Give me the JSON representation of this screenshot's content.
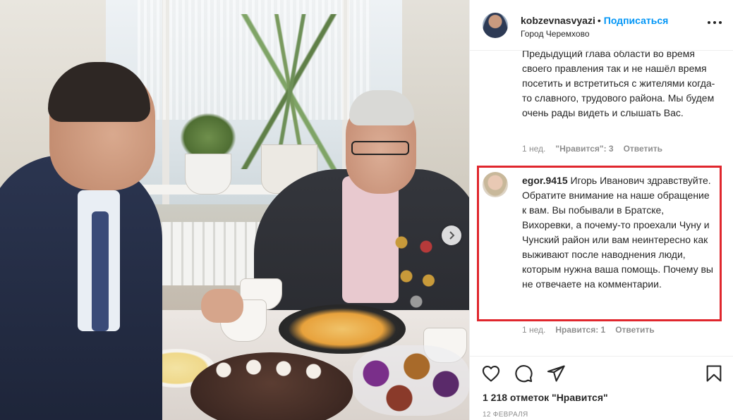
{
  "post": {
    "owner": "kobzevnasvyazi",
    "follow_label": "Подписаться",
    "separator": "•",
    "location": "Город Черемхово"
  },
  "comments": [
    {
      "text": "Предыдущий глава области во время своего правления так и не нашёл время посетить и встретиться с жителями когда-то славного, трудового района. Мы будем очень рады видеть и слышать Вас.",
      "time": "1 нед.",
      "likes": "\"Нравится\": 3",
      "reply": "Ответить"
    },
    {
      "user": "egor.9415",
      "text": "Игорь Иванович здравствуйте. Обратите внимание на наше обращение к вам. Вы побывали в Братске, Вихоревки, а почему-то проехали Чуну и Чунский район или вам неинтересно как выживают после наводнения люди, которым нужна ваша помощь. Почему вы не отвечаете на комментарии.",
      "time": "1 нед.",
      "likes": "Нравится: 1",
      "reply": "Ответить"
    }
  ],
  "footer": {
    "likes_count": "1 218 отметок \"Нравится\"",
    "date": "12 ФЕВРАЛЯ"
  },
  "icons": {
    "like": "heart-outline-icon",
    "comment": "speech-bubble-icon",
    "share": "paper-plane-icon",
    "save": "bookmark-icon",
    "more": "more-horizontal-icon",
    "next": "chevron-right-icon"
  },
  "colors": {
    "link_blue": "#0095f6",
    "highlight_red": "#e0262d",
    "muted_text": "#8e8e8e"
  }
}
